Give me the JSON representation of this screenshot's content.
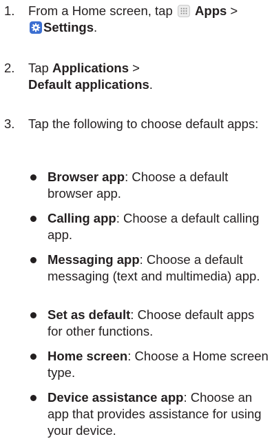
{
  "steps": [
    {
      "number": "1.",
      "pre": "From a Home screen, tap",
      "apps_label": "Apps",
      "sep": ">",
      "settings_label": "Settings",
      "end": "."
    },
    {
      "number": "2.",
      "pre": "Tap",
      "applications_label": "Applications",
      "sep": ">",
      "default_label": "Default applications",
      "end": "."
    },
    {
      "number": "3.",
      "text": "Tap the following to choose default apps:"
    }
  ],
  "bullets": [
    {
      "title": "Browser app",
      "desc": ": Choose a default browser app."
    },
    {
      "title": "Calling app",
      "desc": ": Choose a default calling app."
    },
    {
      "title": "Messaging app",
      "desc": ": Choose a default messaging (text and multimedia) app."
    },
    {
      "title": "Set as default",
      "desc": ": Choose default apps for other functions."
    },
    {
      "title": "Home screen",
      "desc": ": Choose a Home screen type."
    },
    {
      "title": "Device assistance app",
      "desc": ": Choose an app that provides assistance for using your device."
    }
  ],
  "icons": {
    "apps": "apps-grid-icon",
    "settings": "settings-gear-icon",
    "settings_color": "#3c6fd1"
  }
}
